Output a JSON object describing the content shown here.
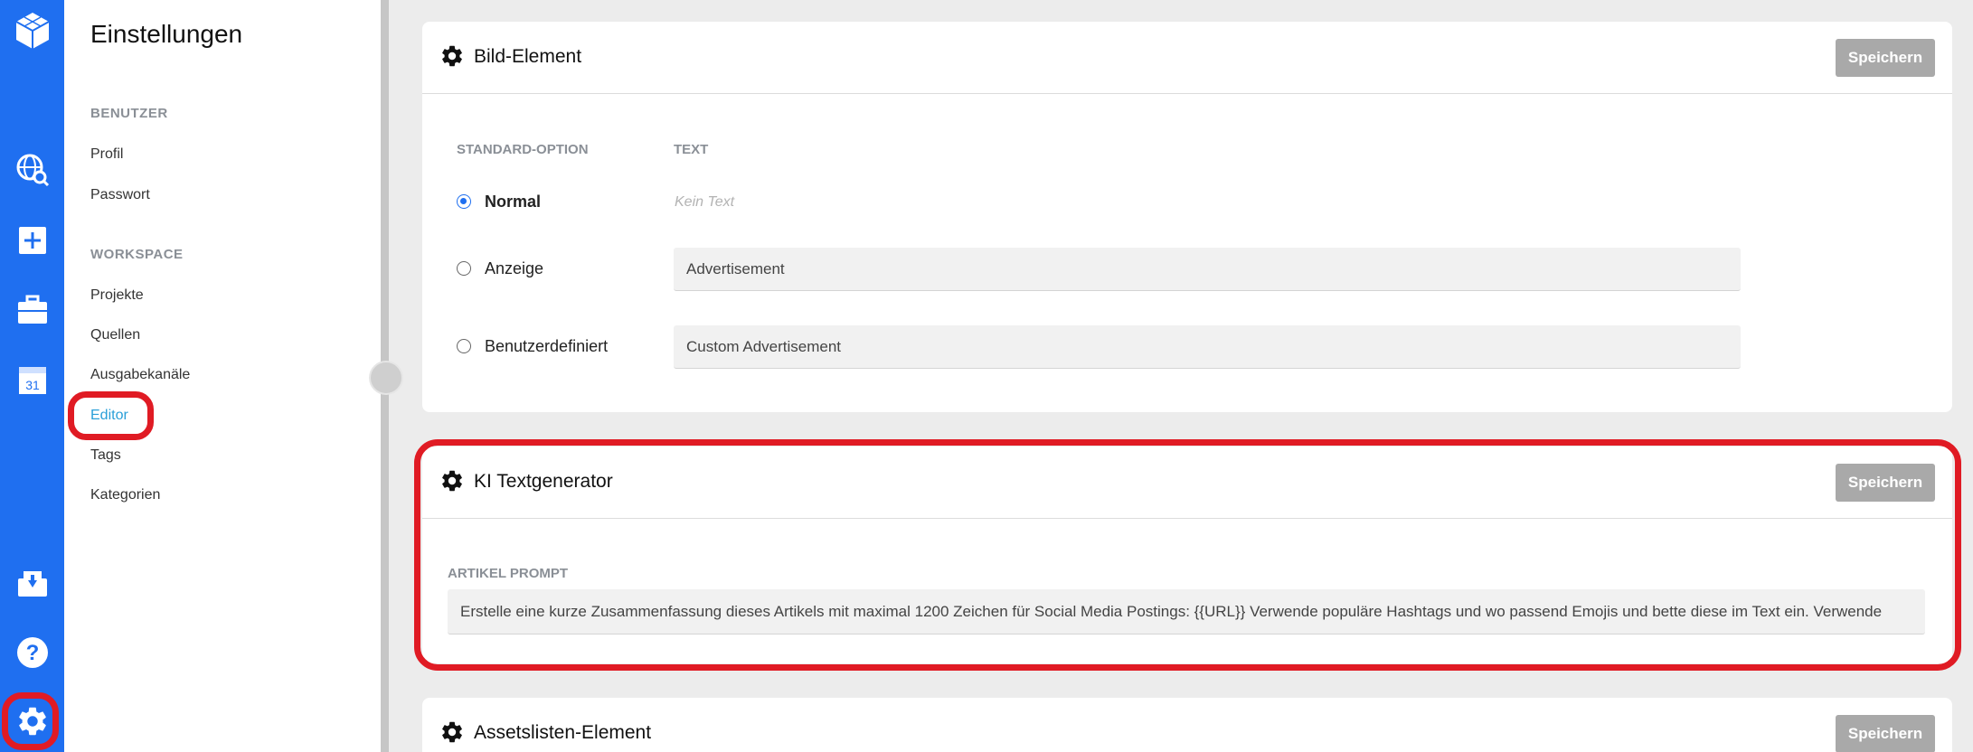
{
  "colors": {
    "rail": "#1f6ff0",
    "highlight": "#e01b24",
    "active_link": "#2a9fd8",
    "save_button": "#a9a9a9"
  },
  "rail": {
    "icons": [
      "logo-cube-icon",
      "globe-search-icon",
      "plus-square-icon",
      "briefcase-icon",
      "calendar-icon",
      "download-tray-icon",
      "help-icon",
      "gear-icon"
    ],
    "calendar_day": "31"
  },
  "sidebar": {
    "title": "Einstellungen",
    "sections": [
      {
        "title": "BENUTZER",
        "items": [
          "Profil",
          "Passwort"
        ]
      },
      {
        "title": "WORKSPACE",
        "items": [
          "Projekte",
          "Quellen",
          "Ausgabekanäle",
          "Editor",
          "Tags",
          "Kategorien"
        ]
      }
    ],
    "active_item": "Editor"
  },
  "cards": {
    "bild": {
      "title": "Bild-Element",
      "save_label": "Speichern",
      "col_option": "STANDARD-OPTION",
      "col_text": "TEXT",
      "options": [
        {
          "label": "Normal",
          "selected": true,
          "text": "Kein Text"
        },
        {
          "label": "Anzeige",
          "selected": false,
          "text": "Advertisement"
        },
        {
          "label": "Benutzerdefiniert",
          "selected": false,
          "text": "Custom Advertisement"
        }
      ]
    },
    "ki": {
      "title": "KI Textgenerator",
      "save_label": "Speichern",
      "prompt_label": "ARTIKEL PROMPT",
      "prompt_value": "Erstelle eine kurze Zusammenfassung dieses Artikels mit maximal 1200 Zeichen für Social Media Postings: {{URL}} Verwende populäre Hashtags und wo passend Emojis und bette diese im Text ein. Verwende"
    },
    "assets": {
      "title": "Assetslisten-Element",
      "save_label": "Speichern"
    }
  }
}
